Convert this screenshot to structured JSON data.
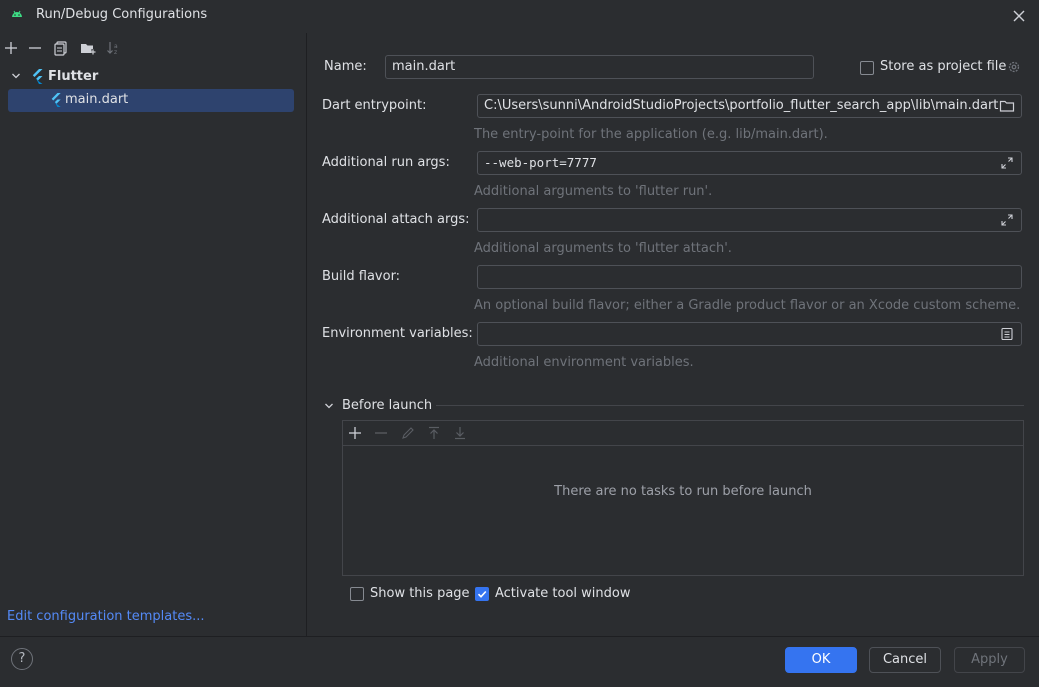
{
  "window": {
    "title": "Run/Debug Configurations"
  },
  "colors": {
    "accent": "#3574f0",
    "selection": "#2e436e",
    "link": "#548af7",
    "flutter": "#4fc3f7"
  },
  "left_toolbar": {
    "icons": [
      "add-icon",
      "remove-icon",
      "copy-icon",
      "new-folder-icon",
      "sort-icon"
    ]
  },
  "tree": {
    "group_label": "Flutter",
    "item_label": "main.dart"
  },
  "left_footer": {
    "edit_templates_link": "Edit configuration templates..."
  },
  "form": {
    "name_label": "Name:",
    "name_value": "main.dart",
    "store_label": "Store as project file",
    "store_checked": false,
    "entrypoint_label": "Dart entrypoint:",
    "entrypoint_value": "C:\\Users\\sunni\\AndroidStudioProjects\\portfolio_flutter_search_app\\lib\\main.dart",
    "entrypoint_hint": "The entry-point for the application (e.g. lib/main.dart).",
    "run_args_label": "Additional run args:",
    "run_args_value": "--web-port=7777",
    "run_args_hint": "Additional arguments to 'flutter run'.",
    "attach_args_label": "Additional attach args:",
    "attach_args_value": "",
    "attach_args_hint": "Additional arguments to 'flutter attach'.",
    "build_flavor_label": "Build flavor:",
    "build_flavor_value": "",
    "build_flavor_hint": "An optional build flavor; either a Gradle product flavor or an Xcode custom scheme.",
    "env_label": "Environment variables:",
    "env_value": "",
    "env_hint": "Additional environment variables."
  },
  "before_launch": {
    "title": "Before launch",
    "empty_text": "There are no tasks to run before launch",
    "toolbar_icons": [
      "add-icon",
      "remove-icon",
      "edit-icon",
      "move-up-icon",
      "move-down-icon"
    ]
  },
  "options": {
    "show_page_label": "Show this page",
    "show_page_checked": false,
    "activate_label": "Activate tool window",
    "activate_checked": true
  },
  "buttons": {
    "help": "?",
    "ok": "OK",
    "cancel": "Cancel",
    "apply": "Apply"
  }
}
